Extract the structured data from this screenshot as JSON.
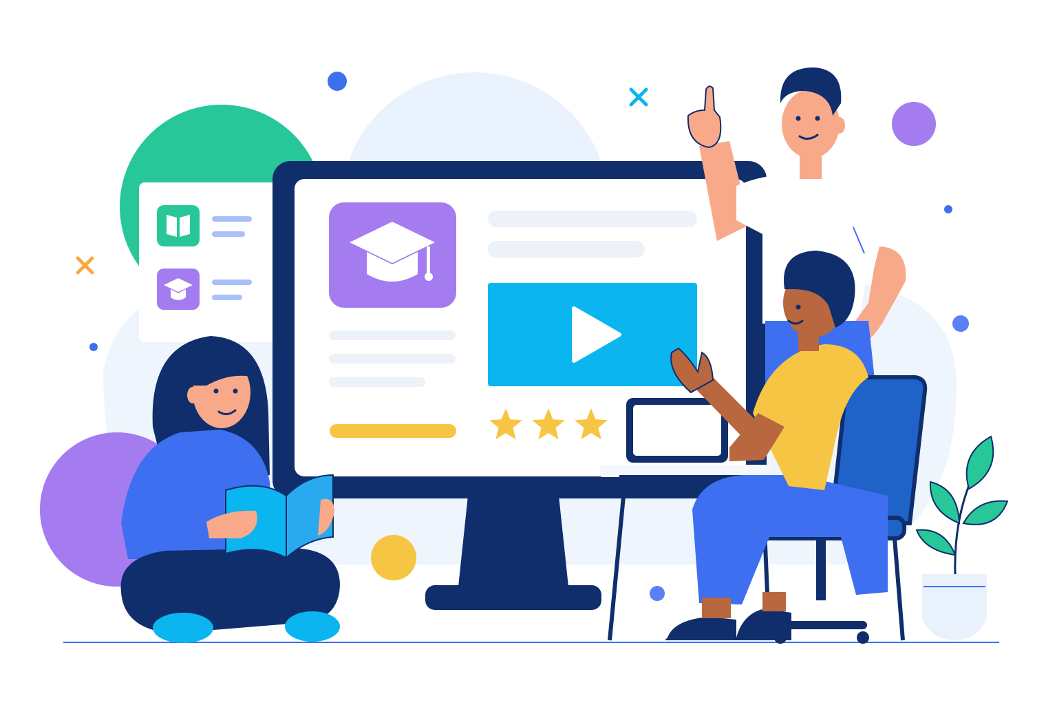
{
  "scene": {
    "subject": "online-learning-illustration",
    "palette": {
      "navy": "#0f2e6b",
      "purple": "#a47cf0",
      "green": "#27c79a",
      "cyan": "#0bb5f0",
      "yellow": "#f7c544",
      "blue": "#3d6ff0",
      "skin_light": "#f7a98a",
      "skin_dark": "#b8673f",
      "background_blob": "#eaf3fd"
    },
    "icons": [
      "graduation-cap-icon",
      "open-book-icon",
      "play-icon",
      "star-icon",
      "close-x-icon",
      "laptop-icon",
      "plant-icon"
    ],
    "rating": {
      "filled": 3,
      "shown": 3
    }
  }
}
